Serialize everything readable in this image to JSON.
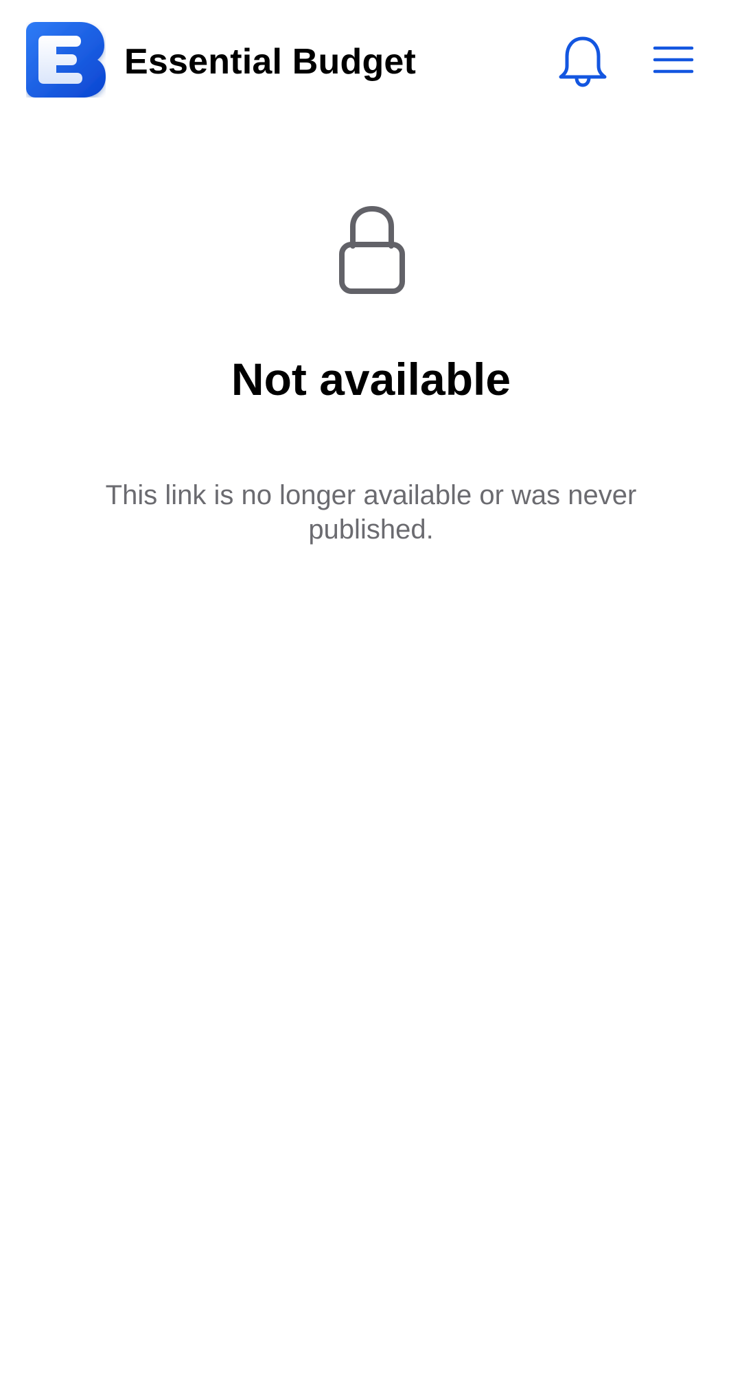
{
  "header": {
    "app_name": "Essential Budget",
    "logo_letter": "E",
    "logo_icon": "essential-budget-logo-icon",
    "notification_icon": "bell-icon",
    "menu_icon": "hamburger-menu-icon"
  },
  "main": {
    "status_icon": "lock-icon",
    "title": "Not available",
    "message": "This link is no longer available or was never published."
  },
  "colors": {
    "accent": "#1356E0",
    "logo_blue": "#1A5FE6",
    "title_text": "#000000",
    "muted_text": "#6B6B70",
    "lock_icon": "#626268",
    "background": "#FFFFFF"
  }
}
